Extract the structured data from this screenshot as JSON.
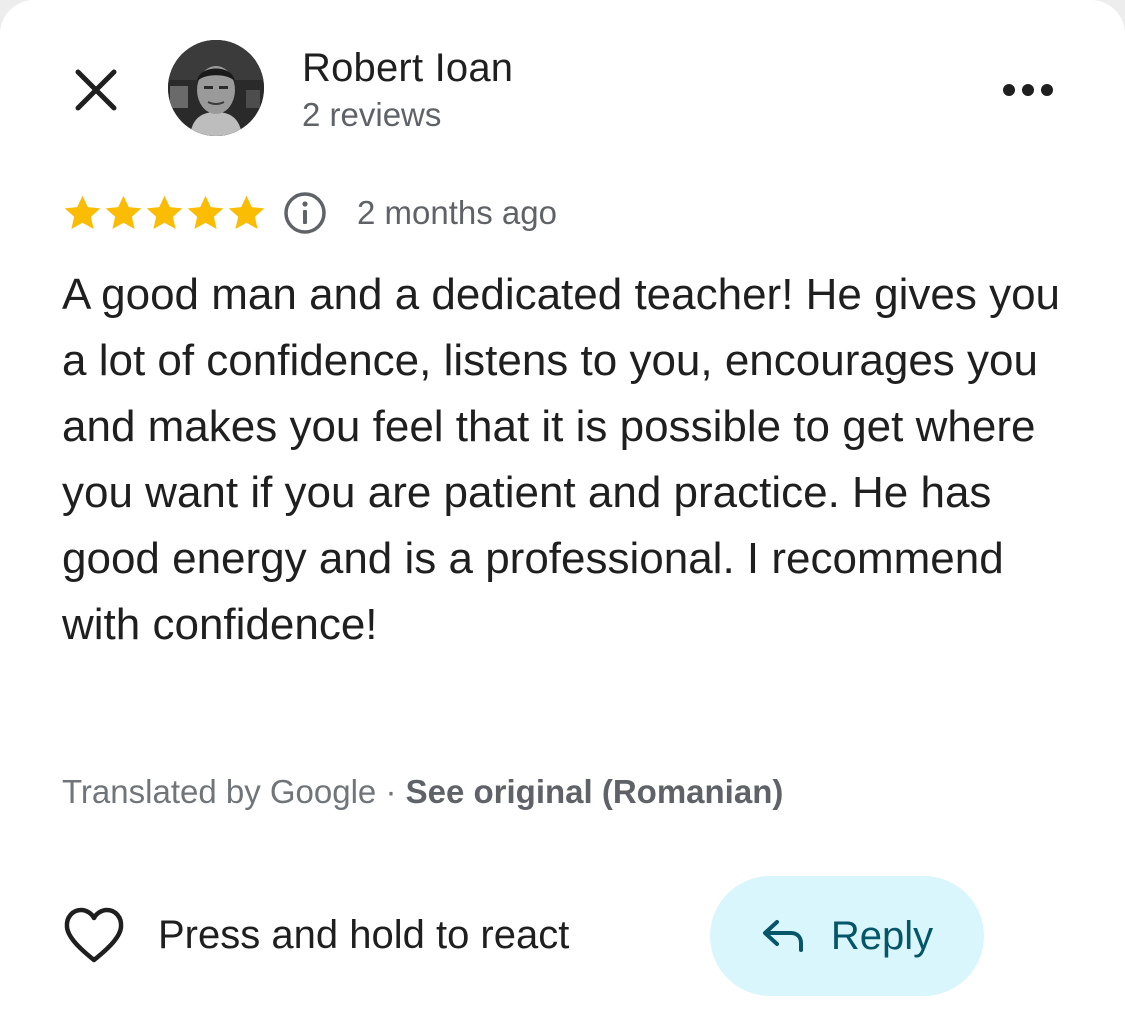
{
  "header": {
    "close_icon": "close-icon",
    "author_name": "Robert Ioan",
    "author_reviews": "2 reviews",
    "more_icon": "more-horizontal-icon"
  },
  "review": {
    "rating": 5,
    "rating_max": 5,
    "date": "2 months ago",
    "text": "A good man and a dedicated teacher! He gives you a lot of confidence, listens to you, encourages you and makes you feel that it is possible to get where you want if you are patient and practice. He has good energy and is a professional. I recommend with confidence!",
    "translated_by": "Translated by Google",
    "separator": " · ",
    "see_original": "See original (Romanian)"
  },
  "actions": {
    "react_label": "Press and hold to react",
    "reply_label": "Reply"
  },
  "colors": {
    "star": "#fbbc04",
    "reply_bg": "#d9f6fd",
    "reply_text": "#06566a",
    "text_primary": "#1f1f1f",
    "text_secondary": "#5f6368"
  }
}
